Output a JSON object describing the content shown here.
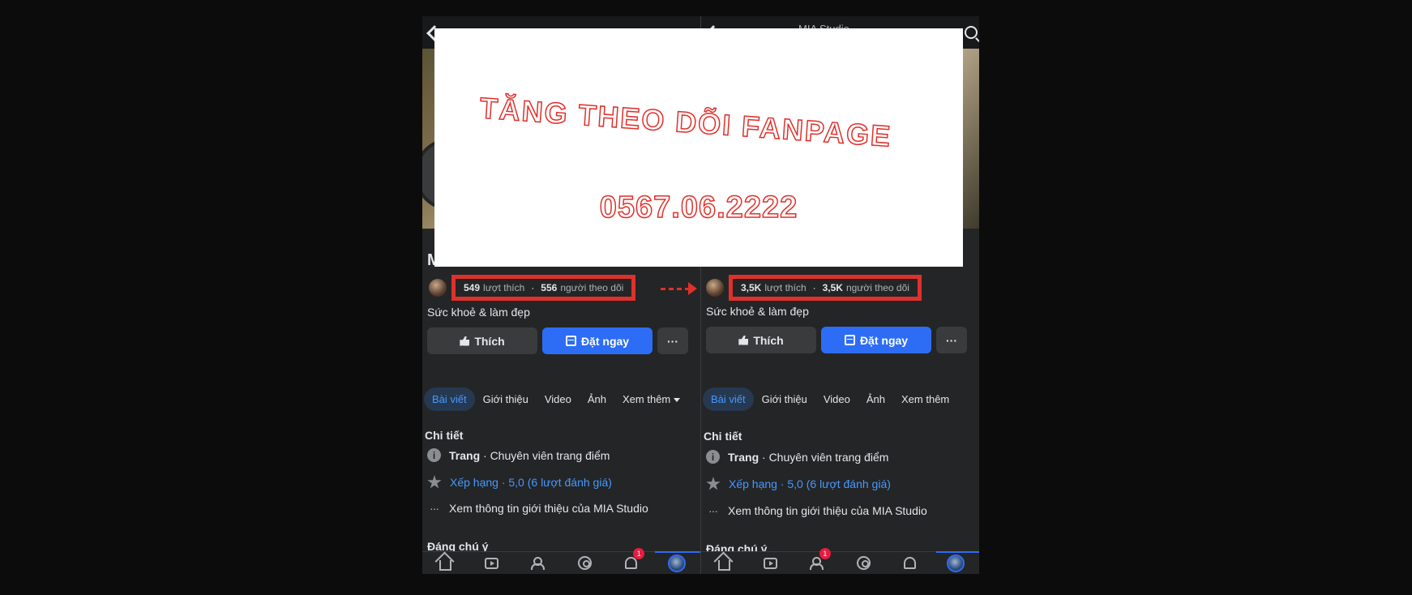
{
  "topbar": {
    "title_partial": "MIA Studio"
  },
  "page_initial": "M",
  "left": {
    "likes_count": "549",
    "likes_label": "lượt thích",
    "followers_count": "556",
    "followers_label": "người theo dõi"
  },
  "right": {
    "likes_count": "3,5K",
    "likes_label": "lượt thích",
    "followers_count": "3,5K",
    "followers_label": "người theo dõi"
  },
  "stats_separator": "·",
  "category": "Sức khoẻ & làm đẹp",
  "buttons": {
    "like": "Thích",
    "book": "Đặt ngay",
    "more": "···"
  },
  "tabs": [
    "Bài viết",
    "Giới thiệu",
    "Video",
    "Ảnh",
    "Xem thêm"
  ],
  "details": {
    "title": "Chi tiết",
    "type_bold": "Trang",
    "type_rest": " · Chuyên viên trang điểm",
    "rating": "Xếp hạng · 5,0 (6 lượt đánh giá)",
    "about": "Xem thông tin giới thiệu của MIA Studio",
    "notable": "Đáng chú ý"
  },
  "icons": {
    "info": "i",
    "dots": "···"
  },
  "notifications": {
    "left_badge": "1",
    "right_badge": "1"
  },
  "overlay": {
    "title": "TĂNG THEO DÕI FANPAGE",
    "phone": "0567.06.2222"
  },
  "colors": {
    "accent": "#2d6df6",
    "highlight": "#e0302b",
    "link": "#4599ff",
    "background": "#242526"
  }
}
